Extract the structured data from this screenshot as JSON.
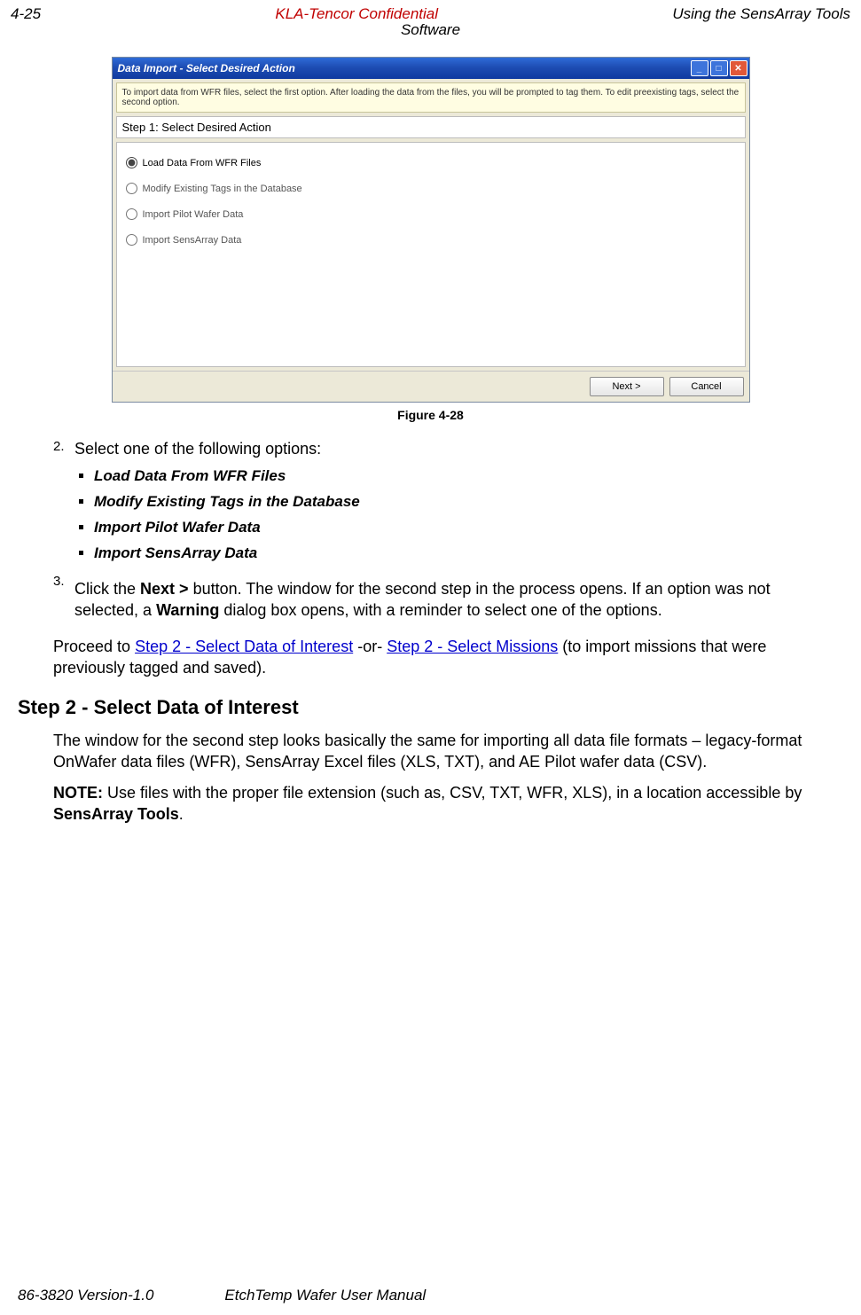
{
  "header": {
    "left": "4-25",
    "center": "KLA-Tencor Confidential",
    "sub": "Software",
    "right": "Using the SensArray Tools"
  },
  "dialog": {
    "title": "Data Import - Select Desired Action",
    "info": "To import data from WFR files, select the first option.  After loading the data from the files, you will be prompted to tag them.  To edit preexisting tags, select the second option.",
    "step_label": "Step 1: Select Desired Action",
    "options": [
      "Load Data From WFR Files",
      "Modify Existing Tags in the Database",
      "Import Pilot Wafer Data",
      "Import SensArray Data"
    ],
    "selected_index": 0,
    "next_btn": "Next >",
    "cancel_btn": "Cancel"
  },
  "figure_caption": "Figure 4-28",
  "body": {
    "step2_intro_num": "2.",
    "step2_intro": "Select one of the following options:",
    "bullets": [
      "Load Data From WFR Files",
      "Modify Existing Tags in the Database",
      "Import Pilot Wafer Data",
      "Import SensArray Data"
    ],
    "step3_num": "3.",
    "step3_a": "Click the ",
    "step3_bold1": "Next >",
    "step3_b": " button. The window for the second step in the process opens. If an option was not selected, a ",
    "step3_bold2": "Warning",
    "step3_c": " dialog box opens, with a reminder to select one of the options.",
    "proceed_a": "Proceed to ",
    "proceed_link1": "Step 2 - Select Data of Interest",
    "proceed_b": " -or- ",
    "proceed_link2": "Step 2 - Select Missions",
    "proceed_c": " (to import missions that were previously tagged and saved).",
    "h2": "Step 2 - Select Data of Interest",
    "para1": "The window for the second step looks basically the same for importing all data file formats – legacy-format OnWafer data files (WFR), SensArray Excel files (XLS, TXT), and AE Pilot wafer data (CSV).",
    "note_label": "NOTE:",
    "note_a": " Use files with the proper file extension (such as, CSV, TXT, WFR, XLS), in a location accessible by ",
    "note_bold": "SensArray Tools",
    "note_b": "."
  },
  "footer": {
    "left": "86-3820 Version-1.0",
    "center": "EtchTemp Wafer User Manual"
  }
}
